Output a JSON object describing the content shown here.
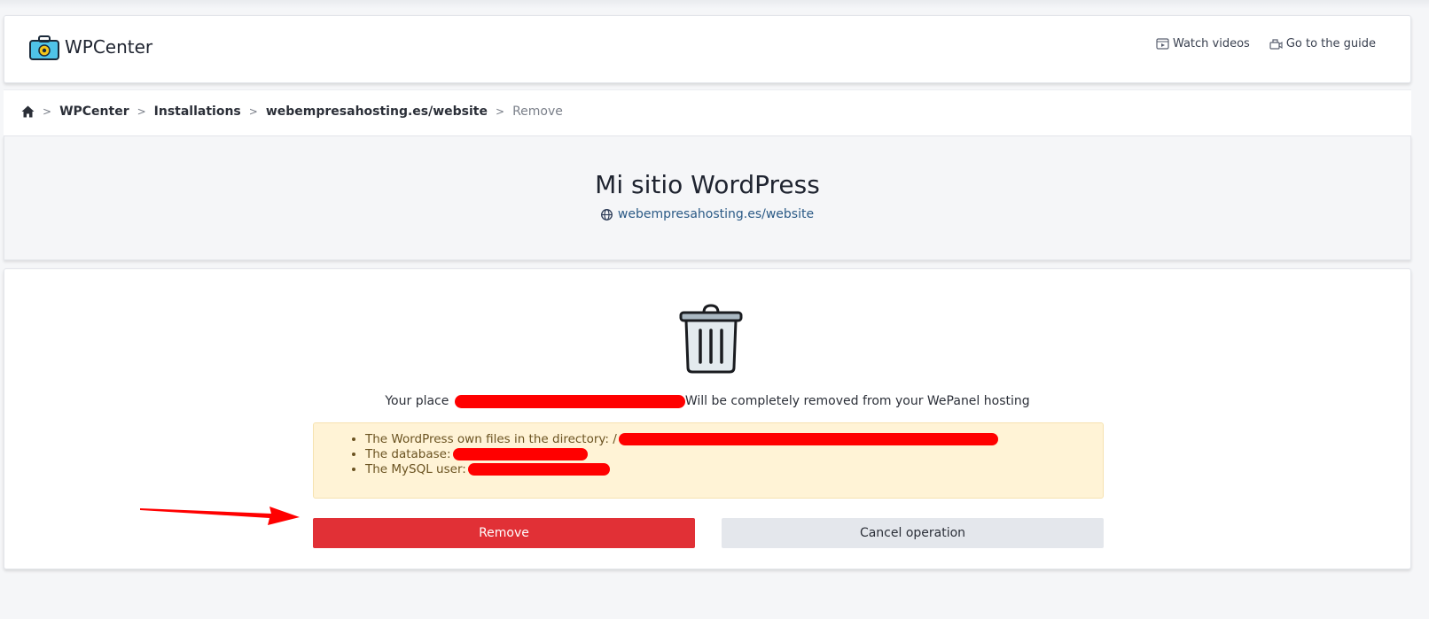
{
  "header": {
    "app_name": "WPCenter",
    "links": [
      {
        "label": "Watch videos",
        "icon": "video-icon"
      },
      {
        "label": "Go to the guide",
        "icon": "guide-icon"
      }
    ]
  },
  "breadcrumb": {
    "items": [
      "WPCenter",
      "Installations",
      "webempresahosting.es/website"
    ],
    "current": "Remove"
  },
  "site": {
    "title": "Mi sitio WordPress",
    "url": "webempresahosting.es/website"
  },
  "removal": {
    "notice_prefix": "Your place",
    "notice_suffix": "Will be completely removed from your WePanel hosting",
    "items": [
      "The WordPress own files in the directory: /",
      "The database:",
      "The MySQL user:"
    ],
    "remove_label": "Remove",
    "cancel_label": "Cancel operation"
  },
  "colors": {
    "remove_button": "#e13036",
    "cancel_button": "#e4e7ec",
    "warning_background": "#fff3d6",
    "link": "#2b5a86",
    "redaction": "#ff0000"
  }
}
